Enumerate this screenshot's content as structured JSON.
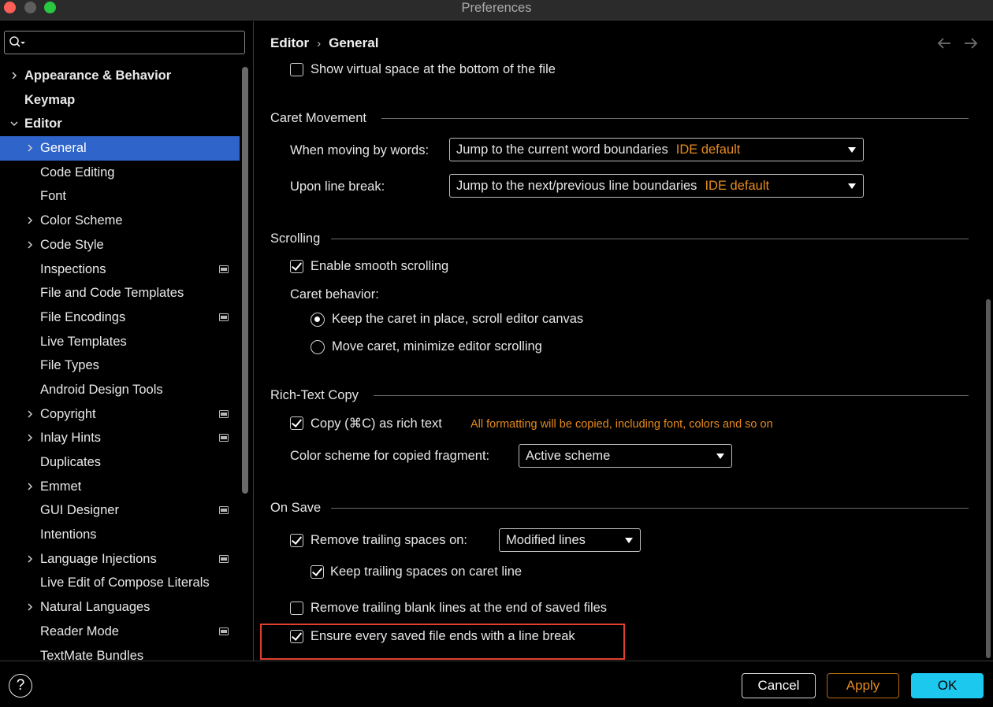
{
  "window": {
    "title": "Preferences"
  },
  "search": {
    "placeholder": ""
  },
  "sidebar": {
    "items": [
      {
        "label": "Appearance & Behavior",
        "level": 0,
        "bold": true,
        "chevron": "right",
        "badge": false
      },
      {
        "label": "Keymap",
        "level": 0,
        "bold": true,
        "chevron": "none",
        "badge": false
      },
      {
        "label": "Editor",
        "level": 0,
        "bold": true,
        "chevron": "down",
        "badge": false
      },
      {
        "label": "General",
        "level": 1,
        "selected": true,
        "chevron": "right",
        "badge": false
      },
      {
        "label": "Code Editing",
        "level": 1,
        "chevron": "none",
        "badge": false
      },
      {
        "label": "Font",
        "level": 1,
        "chevron": "none",
        "badge": false
      },
      {
        "label": "Color Scheme",
        "level": 1,
        "chevron": "right",
        "badge": false
      },
      {
        "label": "Code Style",
        "level": 1,
        "chevron": "right",
        "badge": false
      },
      {
        "label": "Inspections",
        "level": 1,
        "chevron": "none",
        "badge": true
      },
      {
        "label": "File and Code Templates",
        "level": 1,
        "chevron": "none",
        "badge": false
      },
      {
        "label": "File Encodings",
        "level": 1,
        "chevron": "none",
        "badge": true
      },
      {
        "label": "Live Templates",
        "level": 1,
        "chevron": "none",
        "badge": false
      },
      {
        "label": "File Types",
        "level": 1,
        "chevron": "none",
        "badge": false
      },
      {
        "label": "Android Design Tools",
        "level": 1,
        "chevron": "none",
        "badge": false
      },
      {
        "label": "Copyright",
        "level": 1,
        "chevron": "right",
        "badge": true
      },
      {
        "label": "Inlay Hints",
        "level": 1,
        "chevron": "right",
        "badge": true
      },
      {
        "label": "Duplicates",
        "level": 1,
        "chevron": "none",
        "badge": false
      },
      {
        "label": "Emmet",
        "level": 1,
        "chevron": "right",
        "badge": false
      },
      {
        "label": "GUI Designer",
        "level": 1,
        "chevron": "none",
        "badge": true
      },
      {
        "label": "Intentions",
        "level": 1,
        "chevron": "none",
        "badge": false
      },
      {
        "label": "Language Injections",
        "level": 1,
        "chevron": "right",
        "badge": true
      },
      {
        "label": "Live Edit of Compose Literals",
        "level": 1,
        "chevron": "none",
        "badge": false
      },
      {
        "label": "Natural Languages",
        "level": 1,
        "chevron": "right",
        "badge": false
      },
      {
        "label": "Reader Mode",
        "level": 1,
        "chevron": "none",
        "badge": true
      },
      {
        "label": "TextMate Bundles",
        "level": 1,
        "chevron": "none",
        "badge": false
      }
    ]
  },
  "breadcrumb": {
    "parent": "Editor",
    "separator": "›",
    "current": "General"
  },
  "settings": {
    "virtual_space": {
      "label": "Show virtual space at the bottom of the file",
      "checked": false
    },
    "caret_movement": {
      "title": "Caret Movement",
      "words_label": "When moving by words:",
      "words_value": "Jump to the current word boundaries",
      "words_hint": "IDE default",
      "linebreak_label": "Upon line break:",
      "linebreak_value": "Jump to the next/previous line boundaries",
      "linebreak_hint": "IDE default"
    },
    "scrolling": {
      "title": "Scrolling",
      "smooth_label": "Enable smooth scrolling",
      "smooth_checked": true,
      "caret_behavior_label": "Caret behavior:",
      "option1": "Keep the caret in place, scroll editor canvas",
      "option2": "Move caret, minimize editor scrolling",
      "selected_option": 1
    },
    "rich_text": {
      "title": "Rich-Text Copy",
      "copy_label": "Copy (⌘C) as rich text",
      "copy_checked": true,
      "copy_note": "All formatting will be copied, including font, colors and so on",
      "scheme_label": "Color scheme for copied fragment:",
      "scheme_value": "Active scheme"
    },
    "on_save": {
      "title": "On Save",
      "trailing_label": "Remove trailing spaces on:",
      "trailing_checked": true,
      "trailing_value": "Modified lines",
      "keep_caret_label": "Keep trailing spaces on caret line",
      "keep_caret_checked": true,
      "blank_lines_label": "Remove trailing blank lines at the end of saved files",
      "blank_lines_checked": false,
      "line_break_label": "Ensure every saved file ends with a line break",
      "line_break_checked": true
    }
  },
  "footer": {
    "help": "?",
    "cancel": "Cancel",
    "apply": "Apply",
    "ok": "OK"
  },
  "colors": {
    "selection": "#2f65ca",
    "hint": "#e58a1f",
    "ok": "#1cc8ee",
    "highlight": "#e2402c"
  }
}
